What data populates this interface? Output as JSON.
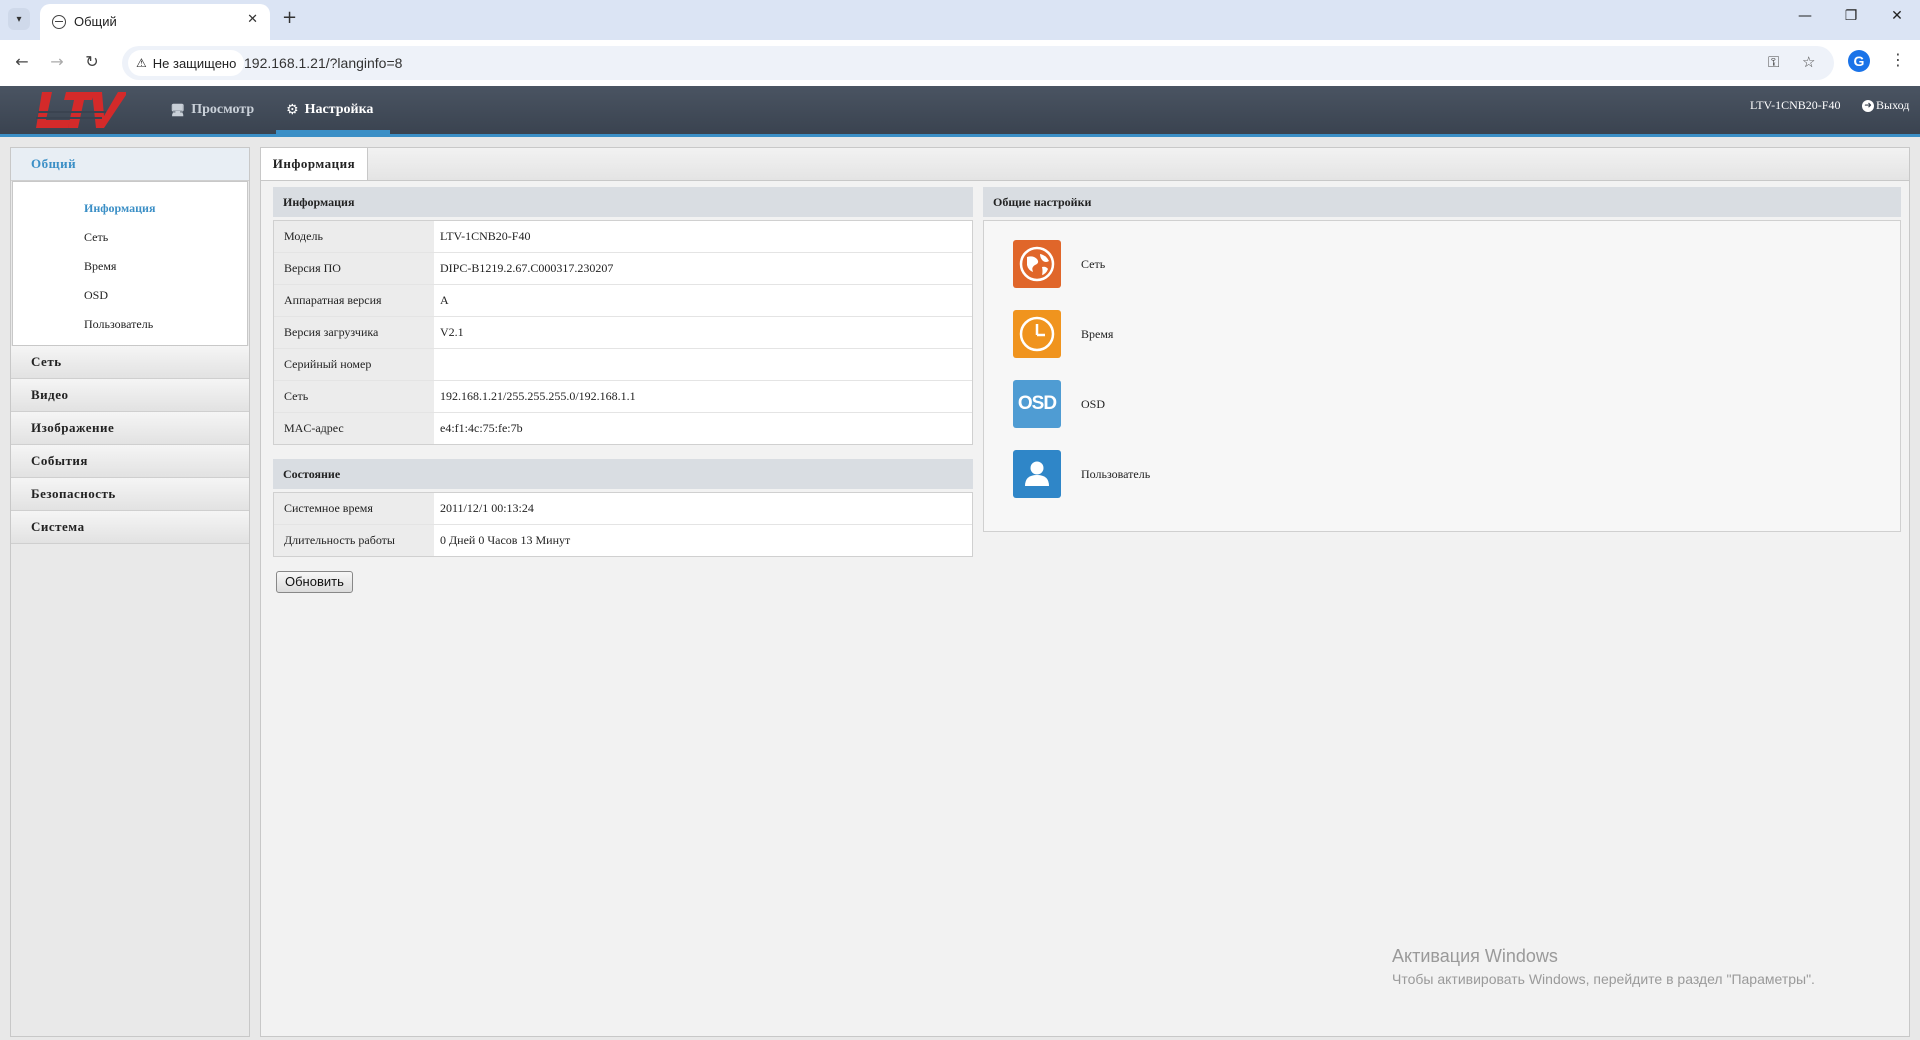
{
  "browser": {
    "tab_title": "Общий",
    "security_label": "Не защищено",
    "url": "192.168.1.21/?langinfo=8",
    "profile_initial": "G"
  },
  "header": {
    "nav": [
      {
        "label": "Просмотр",
        "icon": "monitor-icon"
      },
      {
        "label": "Настройка",
        "icon": "gear-icon"
      }
    ],
    "device_name": "LTV-1CNB20-F40",
    "logout_label": "Выход"
  },
  "sidebar": {
    "sections": [
      {
        "label": "Общий",
        "active": true
      },
      {
        "label": "Сеть"
      },
      {
        "label": "Видео"
      },
      {
        "label": "Изображение"
      },
      {
        "label": "События"
      },
      {
        "label": "Безопасность"
      },
      {
        "label": "Система"
      }
    ],
    "general_items": [
      "Информация",
      "Сеть",
      "Время",
      "OSD",
      "Пользователь"
    ]
  },
  "content": {
    "tab_label": "Информация",
    "info_title": "Информация",
    "info_rows": [
      {
        "key": "Модель",
        "value": "LTV-1CNB20-F40"
      },
      {
        "key": "Версия ПО",
        "value": "DIPC-B1219.2.67.C000317.230207"
      },
      {
        "key": "Аппаратная версия",
        "value": "A"
      },
      {
        "key": "Версия загрузчика",
        "value": "V2.1"
      },
      {
        "key": "Серийный номер",
        "value": ""
      },
      {
        "key": "Сеть",
        "value": "192.168.1.21/255.255.255.0/192.168.1.1"
      },
      {
        "key": "MAC-адрес",
        "value": "e4:f1:4c:75:fe:7b"
      }
    ],
    "state_title": "Состояние",
    "state_rows": [
      {
        "key": "Системное время",
        "value": "2011/12/1 00:13:24"
      },
      {
        "key": "Длительность работы",
        "value": "0 Дней 0 Часов 13 Минут"
      }
    ],
    "refresh_label": "Обновить",
    "settings_title": "Общие настройки",
    "shortcuts": [
      {
        "label": "Сеть",
        "icon": "globe-icon",
        "color": "#e0662a"
      },
      {
        "label": "Время",
        "icon": "clock-icon",
        "color": "#f0941e"
      },
      {
        "label": "OSD",
        "icon": "osd-icon",
        "color": "#4f9cd3",
        "icon_text": "OSD"
      },
      {
        "label": "Пользователь",
        "icon": "user-icon",
        "color": "#2f86c8"
      }
    ]
  },
  "watermark": {
    "line1": "Активация Windows",
    "line2": "Чтобы активировать Windows, перейдите в раздел \"Параметры\"."
  }
}
